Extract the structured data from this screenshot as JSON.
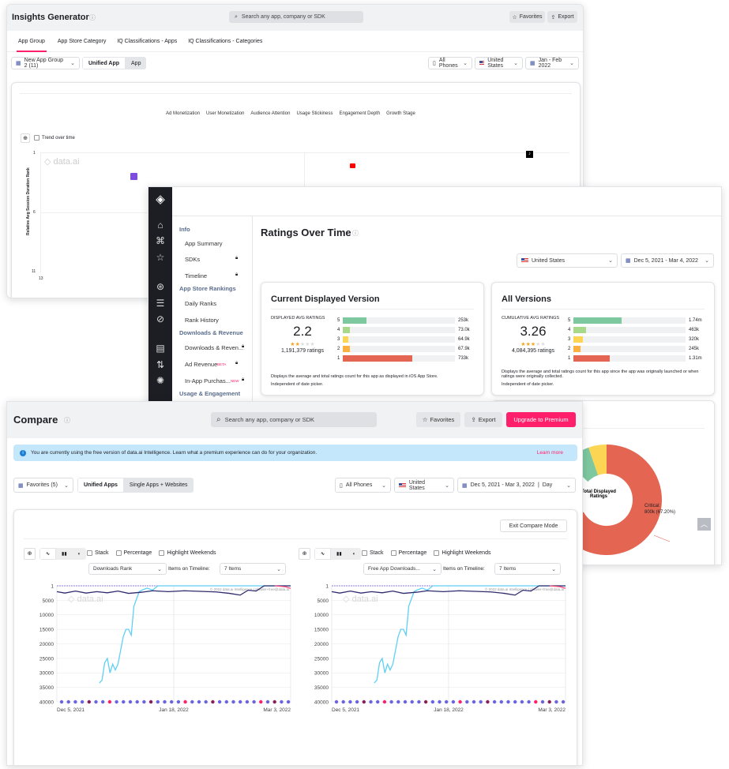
{
  "insights": {
    "title": "Insights Generator",
    "search_placeholder": "Search any app, company or SDK",
    "favorites": "Favorites",
    "export": "Export",
    "tabs": [
      "App Group",
      "App Store Category",
      "IQ Classifications - Apps",
      "IQ Classifications - Categories"
    ],
    "group_select": "New App Group 2 (11)",
    "toggle": [
      "Unified App",
      "App"
    ],
    "device": "All Phones",
    "country": "United States",
    "date": "Jan - Feb 2022",
    "metric_tabs": [
      "Ad Monetization",
      "User Monetization",
      "Audience Attention",
      "Usage Stickiness",
      "Engagement Depth",
      "Growth Stage"
    ],
    "trend_label": "Trend over time",
    "y_axis_label": "Relative Avg Session Duration Rank",
    "y_ticks": [
      "1",
      "6",
      "11"
    ],
    "x_ticks": [
      "13"
    ],
    "watermark": "data.ai",
    "app_icons": [
      "twitch-icon",
      "youtube-icon",
      "tiktok-icon"
    ]
  },
  "ratings": {
    "title": "Ratings Over Time",
    "nav": [
      {
        "type": "header",
        "label": "Info"
      },
      {
        "label": "App Summary"
      },
      {
        "label": "SDKs",
        "locked": true
      },
      {
        "label": "Timeline",
        "locked": true
      },
      {
        "type": "header",
        "label": "App Store Rankings"
      },
      {
        "label": "Daily Ranks"
      },
      {
        "label": "Rank History"
      },
      {
        "type": "header",
        "label": "Downloads & Revenue"
      },
      {
        "label": "Downloads & Reven...",
        "locked": true
      },
      {
        "label": "Ad Revenue",
        "badge": "BETA",
        "locked": true
      },
      {
        "label": "In-App Purchas...",
        "badge": "NEW",
        "locked": true
      },
      {
        "type": "header",
        "label": "Usage & Engagement"
      }
    ],
    "country": "United States",
    "date": "Dec 5, 2021 - Mar 4, 2022",
    "current": {
      "title": "Current Displayed Version",
      "label": "DISPLAYED AVG RATINGS",
      "avg": "2.2",
      "stars": 2.2,
      "count": "1,191,379 ratings",
      "bars": [
        {
          "star": "5",
          "value": "253k",
          "pct": 21
        },
        {
          "star": "4",
          "value": "73.0k",
          "pct": 6
        },
        {
          "star": "3",
          "value": "64.9k",
          "pct": 5
        },
        {
          "star": "2",
          "value": "67.9k",
          "pct": 6
        },
        {
          "star": "1",
          "value": "733k",
          "pct": 62
        }
      ],
      "note": "Displays the average and total ratings count for this app as displayed in iOS App Store.",
      "note2": "Independent of date picker."
    },
    "all": {
      "title": "All Versions",
      "label": "CUMULATIVE AVG RATINGS",
      "avg": "3.26",
      "stars": 3.26,
      "count": "4,084,395 ratings",
      "bars": [
        {
          "star": "5",
          "value": "1.74m",
          "pct": 43
        },
        {
          "star": "4",
          "value": "463k",
          "pct": 11
        },
        {
          "star": "3",
          "value": "320k",
          "pct": 8
        },
        {
          "star": "2",
          "value": "245k",
          "pct": 6
        },
        {
          "star": "1",
          "value": "1.31m",
          "pct": 32
        }
      ],
      "note": "Displays the average and total ratings count for this app since the app was originally launched or when ratings were originally collected.",
      "note2": "Independent of date picker."
    },
    "donut": {
      "center": "Total Displayed Ratings",
      "label": "Critical:",
      "label_value": "800k (67.20%)",
      "partial_label": "%)",
      "slices": [
        {
          "pct": 67.2,
          "color": "#e36552"
        },
        {
          "pct": 20,
          "color": "#ffffff"
        },
        {
          "pct": 7.5,
          "color": "#7ec8a0"
        },
        {
          "pct": 5.3,
          "color": "#fcd554"
        }
      ]
    }
  },
  "compare": {
    "title": "Compare",
    "search_placeholder": "Search any app, company or SDK",
    "favorites": "Favorites",
    "export": "Export",
    "upgrade": "Upgrade to Premium",
    "banner": "You are currently using the free version of data.ai Intelligence. Learn what a premium experience can do for your organization.",
    "learn_more": "Learn more",
    "fav_select": "Favorites (5)",
    "toggle": [
      "Unified Apps",
      "Single Apps + Websites"
    ],
    "device": "All Phones",
    "country": "United States",
    "date": "Dec 5, 2021 - Mar 3, 2022",
    "granularity": "Day",
    "exit": "Exit Compare Mode",
    "options": [
      "Stack",
      "Percentage",
      "Highlight Weekends"
    ],
    "items_label": "Items on Timeline:",
    "items_value": "7 Items",
    "metrics": [
      "Downloads Rank",
      "Free App Downloads..."
    ],
    "copyright": "© 2022 data.ai Intelligence | afowler+free@data.ai"
  },
  "colors": {
    "accent": "#ff1f6b",
    "blue_series": "#5fd0f5",
    "navy_series": "#2e2a6e",
    "pink_series": "#ff4d7a",
    "banner_bg": "#c5e7fb"
  },
  "chart_data": [
    {
      "type": "line",
      "title": "",
      "y_reversed": true,
      "ylim": [
        1,
        40000
      ],
      "y_ticks": [
        "1",
        "5000",
        "10000",
        "15000",
        "20000",
        "25000",
        "30000",
        "35000",
        "40000"
      ],
      "x_ticks": [
        "Dec 5, 2021",
        "Jan 18, 2022",
        "Mar 3, 2022"
      ],
      "xlim": [
        "2021-12-05",
        "2022-03-03"
      ],
      "grid": true,
      "series": [
        {
          "color": "#5fd0f5",
          "points": [
            [
              "2021-12-21",
              33500
            ],
            [
              "2021-12-22",
              32500
            ],
            [
              "2021-12-23",
              26500
            ],
            [
              "2021-12-24",
              25000
            ],
            [
              "2021-12-25",
              30000
            ],
            [
              "2021-12-26",
              27000
            ],
            [
              "2021-12-27",
              29000
            ],
            [
              "2021-12-28",
              27000
            ],
            [
              "2021-12-30",
              17500
            ],
            [
              "2021-12-31",
              15000
            ],
            [
              "2022-01-01",
              15000
            ],
            [
              "2022-01-02",
              17000
            ],
            [
              "2022-01-03",
              7000
            ],
            [
              "2022-01-05",
              2000
            ],
            [
              "2022-01-06",
              1500
            ],
            [
              "2022-01-08",
              800
            ],
            [
              "2022-01-10",
              1500
            ],
            [
              "2022-01-12",
              1
            ],
            [
              "2022-03-03",
              1
            ]
          ]
        },
        {
          "color": "#2e2a6e",
          "points": [
            [
              "2021-12-05",
              2000
            ],
            [
              "2021-12-08",
              2500
            ],
            [
              "2021-12-12",
              1800
            ],
            [
              "2021-12-16",
              2500
            ],
            [
              "2021-12-20",
              2000
            ],
            [
              "2021-12-24",
              2400
            ],
            [
              "2021-12-28",
              1800
            ],
            [
              "2022-01-01",
              2600
            ],
            [
              "2022-01-06",
              2200
            ],
            [
              "2022-01-10",
              1700
            ],
            [
              "2022-01-16",
              2000
            ],
            [
              "2022-01-22",
              1700
            ],
            [
              "2022-01-28",
              1900
            ],
            [
              "2022-02-03",
              2100
            ],
            [
              "2022-02-08",
              2600
            ],
            [
              "2022-02-12",
              3200
            ],
            [
              "2022-02-15",
              1500
            ],
            [
              "2022-02-18",
              1800
            ],
            [
              "2022-02-21",
              1
            ],
            [
              "2022-03-03",
              1
            ]
          ]
        },
        {
          "color": "#ff4d7a",
          "points": [
            [
              "2022-02-25",
              1
            ],
            [
              "2022-03-01",
              300
            ],
            [
              "2022-03-03",
              900
            ]
          ]
        }
      ]
    },
    {
      "type": "line",
      "title": "",
      "y_reversed": true,
      "ylim": [
        1,
        40000
      ],
      "y_ticks": [
        "1",
        "5000",
        "10000",
        "15000",
        "20000",
        "25000",
        "30000",
        "35000",
        "40000"
      ],
      "x_ticks": [
        "Dec 5, 2021",
        "Jan 18, 2022",
        "Mar 3, 2022"
      ],
      "xlim": [
        "2021-12-05",
        "2022-03-03"
      ],
      "grid": true,
      "series": [
        {
          "color": "#5fd0f5",
          "points": [
            [
              "2021-12-21",
              33500
            ],
            [
              "2021-12-22",
              32500
            ],
            [
              "2021-12-23",
              26500
            ],
            [
              "2021-12-24",
              25000
            ],
            [
              "2021-12-25",
              30000
            ],
            [
              "2021-12-26",
              27000
            ],
            [
              "2021-12-27",
              29000
            ],
            [
              "2021-12-28",
              27000
            ],
            [
              "2021-12-30",
              17500
            ],
            [
              "2021-12-31",
              15000
            ],
            [
              "2022-01-01",
              15000
            ],
            [
              "2022-01-02",
              17000
            ],
            [
              "2022-01-03",
              7000
            ],
            [
              "2022-01-05",
              2000
            ],
            [
              "2022-01-06",
              1500
            ],
            [
              "2022-01-08",
              800
            ],
            [
              "2022-01-10",
              1500
            ],
            [
              "2022-01-12",
              1
            ],
            [
              "2022-03-03",
              1
            ]
          ]
        },
        {
          "color": "#2e2a6e",
          "points": [
            [
              "2021-12-05",
              2000
            ],
            [
              "2021-12-08",
              2500
            ],
            [
              "2021-12-12",
              1800
            ],
            [
              "2021-12-16",
              2500
            ],
            [
              "2021-12-20",
              2000
            ],
            [
              "2021-12-24",
              2400
            ],
            [
              "2021-12-28",
              1800
            ],
            [
              "2022-01-01",
              2600
            ],
            [
              "2022-01-06",
              2200
            ],
            [
              "2022-01-10",
              1700
            ],
            [
              "2022-01-16",
              2000
            ],
            [
              "2022-01-22",
              1700
            ],
            [
              "2022-01-28",
              1900
            ],
            [
              "2022-02-03",
              2100
            ],
            [
              "2022-02-08",
              2600
            ],
            [
              "2022-02-12",
              3200
            ],
            [
              "2022-02-15",
              1500
            ],
            [
              "2022-02-18",
              1800
            ],
            [
              "2022-02-21",
              1
            ],
            [
              "2022-03-03",
              1
            ]
          ]
        },
        {
          "color": "#ff4d7a",
          "points": [
            [
              "2022-02-25",
              1
            ],
            [
              "2022-03-01",
              300
            ],
            [
              "2022-03-03",
              900
            ]
          ]
        }
      ]
    }
  ]
}
